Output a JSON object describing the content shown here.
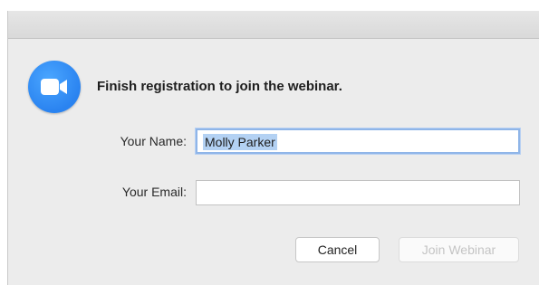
{
  "dialog": {
    "heading": "Finish registration to join the webinar.",
    "icon": "zoom-video-camera-icon",
    "accent_color": "#2d8cff"
  },
  "form": {
    "name_label": "Your Name:",
    "name_value": "Molly Parker",
    "email_label": "Your Email:",
    "email_value": ""
  },
  "buttons": {
    "cancel_label": "Cancel",
    "join_label": "Join Webinar",
    "join_enabled": false
  }
}
